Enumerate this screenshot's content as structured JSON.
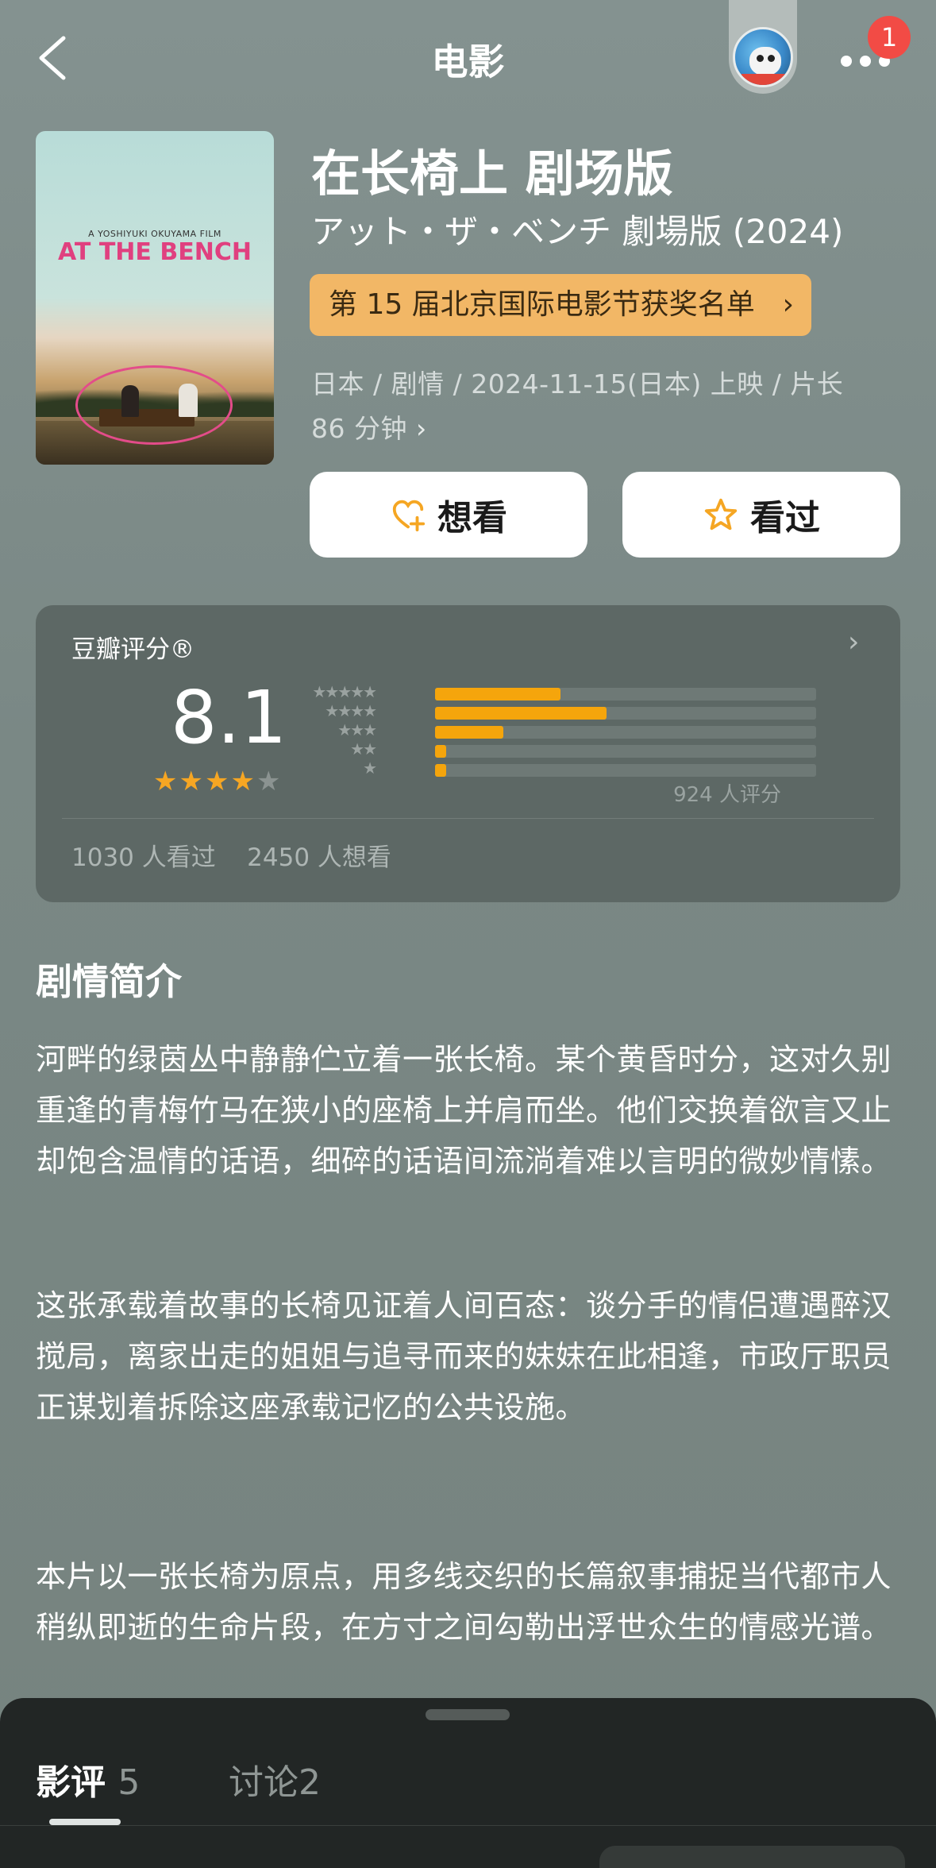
{
  "nav": {
    "title": "电影",
    "notification_count": "1"
  },
  "movie": {
    "title": "在长椅上 剧场版",
    "original_title": "アット・ザ・ベンチ 劇場版 (2024)",
    "award": "第 15 届北京国际电影节获奖名单",
    "meta": "日本 / 剧情 / 2024-11-15(日本) 上映 / 片长 86 分钟",
    "poster": {
      "director_line": "A YOSHIYUKI OKUYAMA FILM",
      "title": "AT THE BENCH"
    }
  },
  "actions": {
    "want_label": "想看",
    "seen_label": "看过"
  },
  "rating": {
    "label": "豆瓣评分®",
    "score": "8.1",
    "stars": 4,
    "max_stars": 5,
    "distribution": [
      {
        "stars": 5,
        "fraction": 0.33
      },
      {
        "stars": 4,
        "fraction": 0.45
      },
      {
        "stars": 3,
        "fraction": 0.18
      },
      {
        "stars": 2,
        "fraction": 0.03
      },
      {
        "stars": 1,
        "fraction": 0.03
      }
    ],
    "count_text": "924 人评分",
    "watched_text": "1030 人看过",
    "want_text": "2450 人想看",
    "bar_color": "#f5a50c"
  },
  "synopsis": {
    "heading": "剧情简介",
    "paragraphs": [
      "河畔的绿茵丛中静静伫立着一张长椅。某个黄昏时分，这对久别重逢的青梅竹马在狭小的座椅上并肩而坐。他们交换着欲言又止却饱含温情的话语，细碎的话语间流淌着难以言明的微妙情愫。",
      "这张承载着故事的长椅见证着人间百态：谈分手的情侣遭遇醉汉搅局，离家出走的姐姐与追寻而来的妹妹在此相逢，市政厅职员正谋划着拆除这座承载记忆的公共设施。",
      "本片以一张长椅为原点，用多线交织的长篇叙事捕捉当代都市人稍纵即逝的生命片段，在方寸之间勾勒出浮世众生的情感光谱。"
    ]
  },
  "sheet": {
    "tabs": [
      {
        "label": "影评",
        "count": "5"
      },
      {
        "label": "讨论",
        "count": "2"
      }
    ]
  },
  "colors": {
    "accent_orange": "#f5a623",
    "award_chip": "#f2b766",
    "background": "#7c8a86"
  }
}
